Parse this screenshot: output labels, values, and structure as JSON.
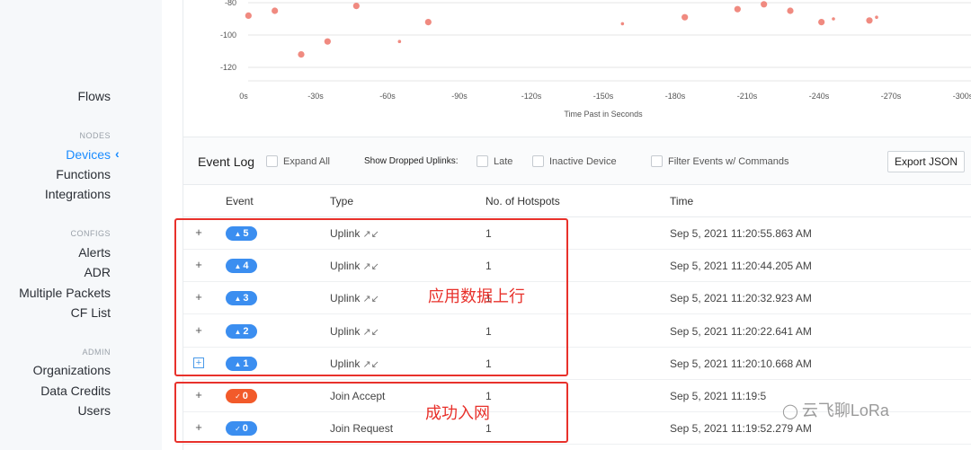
{
  "sidebar": {
    "flows": "Flows",
    "nodes_section": "NODES",
    "devices": "Devices",
    "functions": "Functions",
    "integrations": "Integrations",
    "configs_section": "CONFIGS",
    "alerts": "Alerts",
    "adr": "ADR",
    "multiple_packets": "Multiple Packets",
    "cf_list": "CF List",
    "admin_section": "ADMIN",
    "organizations": "Organizations",
    "data_credits": "Data Credits",
    "users": "Users",
    "active_chevron_icon": "chevron-left-icon"
  },
  "chart_data": {
    "type": "scatter",
    "xlabel": "Time Past in Seconds",
    "x_ticks": [
      "0s",
      "-30s",
      "-60s",
      "-90s",
      "-120s",
      "-150s",
      "-180s",
      "-210s",
      "-240s",
      "-270s",
      "-300s"
    ],
    "y_ticks": [
      "-80",
      "-100",
      "-120"
    ],
    "xlim": [
      0,
      -300
    ],
    "ylim": [
      -125,
      -78
    ],
    "points": [
      {
        "x": -2,
        "y": -88,
        "size": "large"
      },
      {
        "x": -13,
        "y": -85,
        "size": "large"
      },
      {
        "x": -24,
        "y": -112,
        "size": "large"
      },
      {
        "x": -35,
        "y": -104,
        "size": "large"
      },
      {
        "x": -47,
        "y": -82,
        "size": "large"
      },
      {
        "x": -65,
        "y": -104,
        "size": "small"
      },
      {
        "x": -77,
        "y": -92,
        "size": "large"
      },
      {
        "x": -158,
        "y": -93,
        "size": "small"
      },
      {
        "x": -184,
        "y": -89,
        "size": "large"
      },
      {
        "x": -206,
        "y": -84,
        "size": "large"
      },
      {
        "x": -217,
        "y": -81,
        "size": "large"
      },
      {
        "x": -228,
        "y": -85,
        "size": "large"
      },
      {
        "x": -241,
        "y": -92,
        "size": "large"
      },
      {
        "x": -246,
        "y": -90,
        "size": "small"
      },
      {
        "x": -261,
        "y": -91,
        "size": "large"
      },
      {
        "x": -264,
        "y": -89,
        "size": "small"
      }
    ],
    "point_color": "#f08a80",
    "grid": true
  },
  "event_log": {
    "title": "Event Log",
    "expand_all": "Expand All",
    "show_dropped": "Show Dropped Uplinks:",
    "late": "Late",
    "inactive_device": "Inactive Device",
    "filter_events": "Filter Events w/ Commands",
    "export_json": "Export JSON"
  },
  "table": {
    "headers": {
      "event": "Event",
      "type": "Type",
      "hotspots": "No. of Hotspots",
      "time": "Time"
    },
    "rows": [
      {
        "expand": "+",
        "badge": "5",
        "badge_icon": "▲",
        "badge_color": "blue",
        "type": "Uplink",
        "hotspots": "1",
        "time": "Sep 5, 2021 11:20:55.863 AM"
      },
      {
        "expand": "+",
        "badge": "4",
        "badge_icon": "▲",
        "badge_color": "blue",
        "type": "Uplink",
        "hotspots": "1",
        "time": "Sep 5, 2021 11:20:44.205 AM"
      },
      {
        "expand": "+",
        "badge": "3",
        "badge_icon": "▲",
        "badge_color": "blue",
        "type": "Uplink",
        "hotspots": "1",
        "time": "Sep 5, 2021 11:20:32.923 AM"
      },
      {
        "expand": "+",
        "badge": "2",
        "badge_icon": "▲",
        "badge_color": "blue",
        "type": "Uplink",
        "hotspots": "1",
        "time": "Sep 5, 2021 11:20:22.641 AM"
      },
      {
        "expand": "+",
        "badge": "1",
        "badge_icon": "▲",
        "badge_color": "blue",
        "type": "Uplink",
        "hotspots": "1",
        "time": "Sep 5, 2021 11:20:10.668 AM"
      },
      {
        "expand": "+",
        "badge": "0",
        "badge_icon": "✓",
        "badge_color": "red",
        "type": "Join Accept",
        "hotspots": "1",
        "time": "Sep 5, 2021 11:19:5"
      },
      {
        "expand": "+",
        "badge": "0",
        "badge_icon": "✓",
        "badge_color": "blue",
        "type": "Join Request",
        "hotspots": "1",
        "time": "Sep 5, 2021 11:19:52.279 AM"
      }
    ],
    "uplink_arrows_icon": "↗↙"
  },
  "annotations": {
    "uplink_note": "应用数据上行",
    "join_note": "成功入网",
    "watermark": "云飞聊LoRa",
    "watermark_icon": "wechat-icon",
    "color": "#e8312b"
  }
}
